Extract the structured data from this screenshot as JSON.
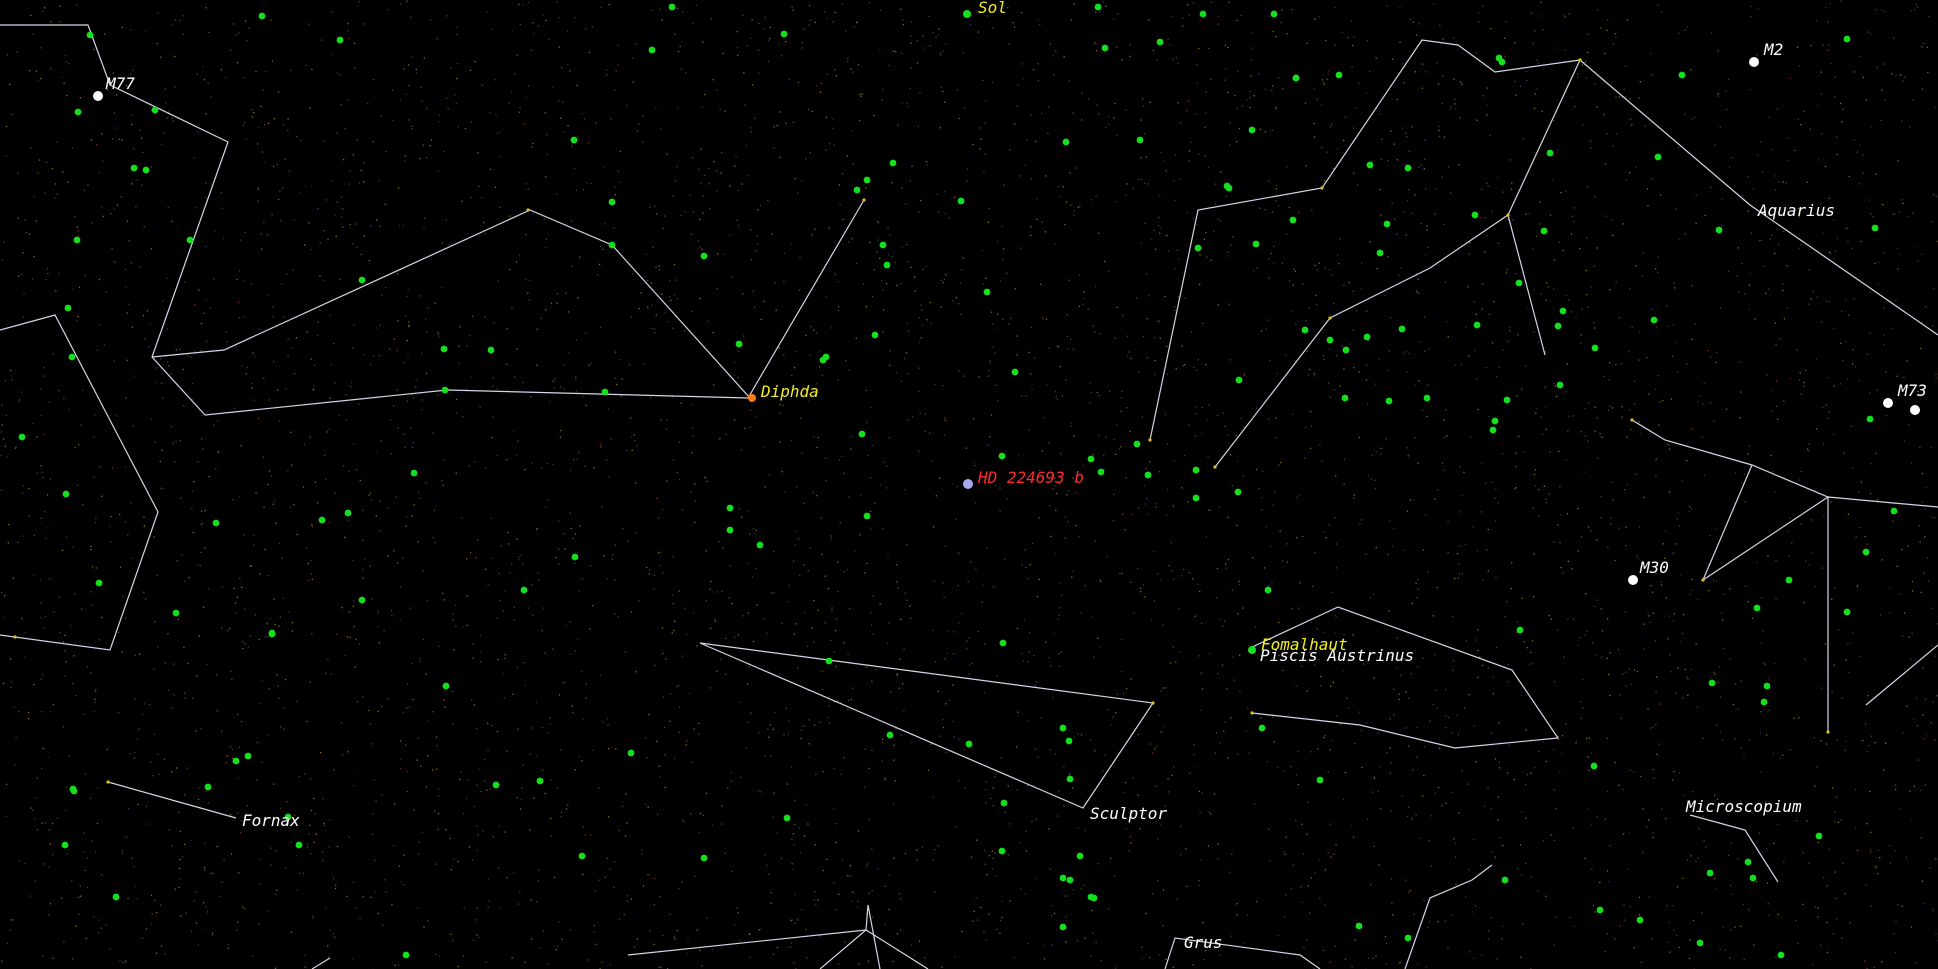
{
  "view": {
    "background": "#000000",
    "line_color": "#d6d6e6",
    "exoplanet_color": "#ff2a2a",
    "named_star_color": "#f2ee20",
    "deep_sky_color": "#ffffff",
    "field_star_color": "#14e01e"
  },
  "labels": {
    "sol": "Sol",
    "m77": "M77",
    "m2": "M2",
    "m73": "M73",
    "m30": "M30",
    "aquarius": "Aquarius",
    "diphda": "Diphda",
    "target": "HD 224693 b",
    "fomalhaut": "Fomalhaut",
    "piscis_austrinus": "Piscis Austrinus",
    "fornax": "Fornax",
    "sculptor": "Sculptor",
    "microscopium": "Microscopium",
    "grus": "Grus"
  }
}
